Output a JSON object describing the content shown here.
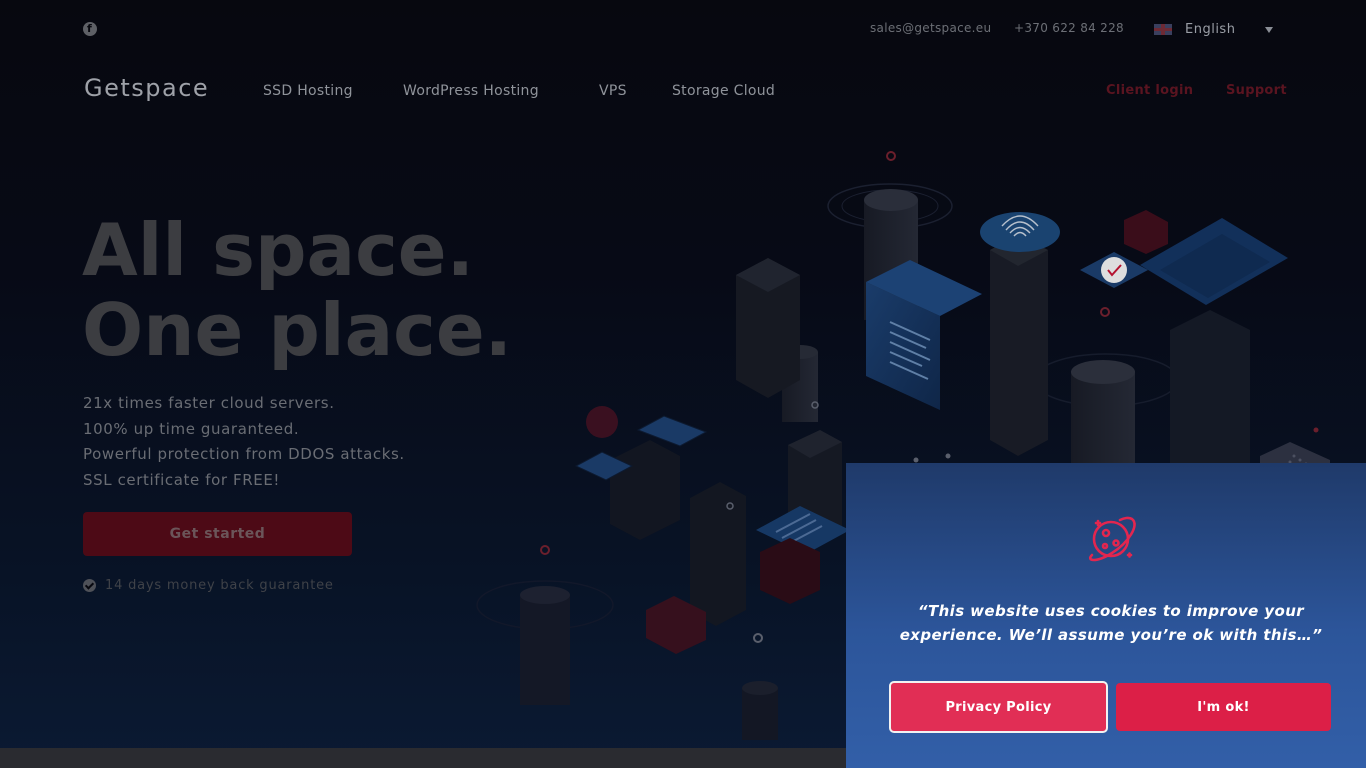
{
  "topbar": {
    "facebook_icon": "facebook-icon",
    "email": "sales@getspace.eu",
    "phone": "+370 622 84 228",
    "language": "English",
    "flag_icon": "uk-flag-icon"
  },
  "nav": {
    "logo": "Getspace",
    "items": [
      {
        "label": "SSD Hosting"
      },
      {
        "label": "WordPress Hosting"
      },
      {
        "label": "VPS"
      },
      {
        "label": "Storage Cloud"
      }
    ],
    "client_login": "Client login",
    "support": "Support"
  },
  "hero": {
    "title_line1": "All space.",
    "title_line2": "One place.",
    "features": [
      "21x times faster cloud servers.",
      "100% up time guaranteed.",
      "Powerful protection from DDOS attacks.",
      "SSL certificate for FREE!"
    ],
    "cta_label": "Get started",
    "guarantee": "14 days money back guarantee"
  },
  "cookie": {
    "icon": "planet-icon",
    "message": "“This website uses cookies to improve your experience. We’ll assume you’re ok with this…”",
    "privacy_label": "Privacy Policy",
    "ok_label": "I'm ok!"
  },
  "colors": {
    "accent": "#dc1f47",
    "cookie_panel": "#2c559a",
    "background": "#07080f"
  }
}
